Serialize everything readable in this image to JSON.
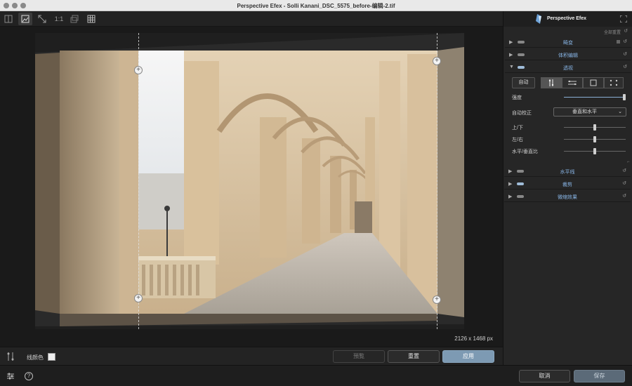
{
  "window": {
    "title": "Perspective Efex - Solli Kanani_DSC_5575_before-编辑-2.tif"
  },
  "toolbar": {
    "zoom_label": "1:1"
  },
  "canvas": {
    "dimensions": "2126 x 1468 px"
  },
  "bottom_bar": {
    "line_color_label": "线颜色",
    "line_color": "#eeeeee",
    "preview_label": "預覧",
    "reset_label": "重置",
    "apply_label": "应用"
  },
  "footer": {
    "cancel_label": "取消",
    "save_label": "保存"
  },
  "panel": {
    "title": "Perspective Efex",
    "reset_all": "全部重置",
    "sections": {
      "distortion": "畸变",
      "volume": "体积编辑",
      "perspective": "透视",
      "horizon": "水平线",
      "crop": "裁剪",
      "fine": "微缩效果"
    },
    "perspective": {
      "auto_label": "自动",
      "strength_label": "强度",
      "strength": 1.0,
      "auto_correct_label": "自动校正",
      "auto_correct_value": "垂直和水平",
      "up_down_label": "上/下",
      "up_down": 0.5,
      "left_right_label": "左/右",
      "left_right": 0.5,
      "ratio_label": "水平/垂直比",
      "ratio": 0.5
    }
  },
  "colors": {
    "accent": "#7d9ab3",
    "section_title": "#88b5e6"
  }
}
